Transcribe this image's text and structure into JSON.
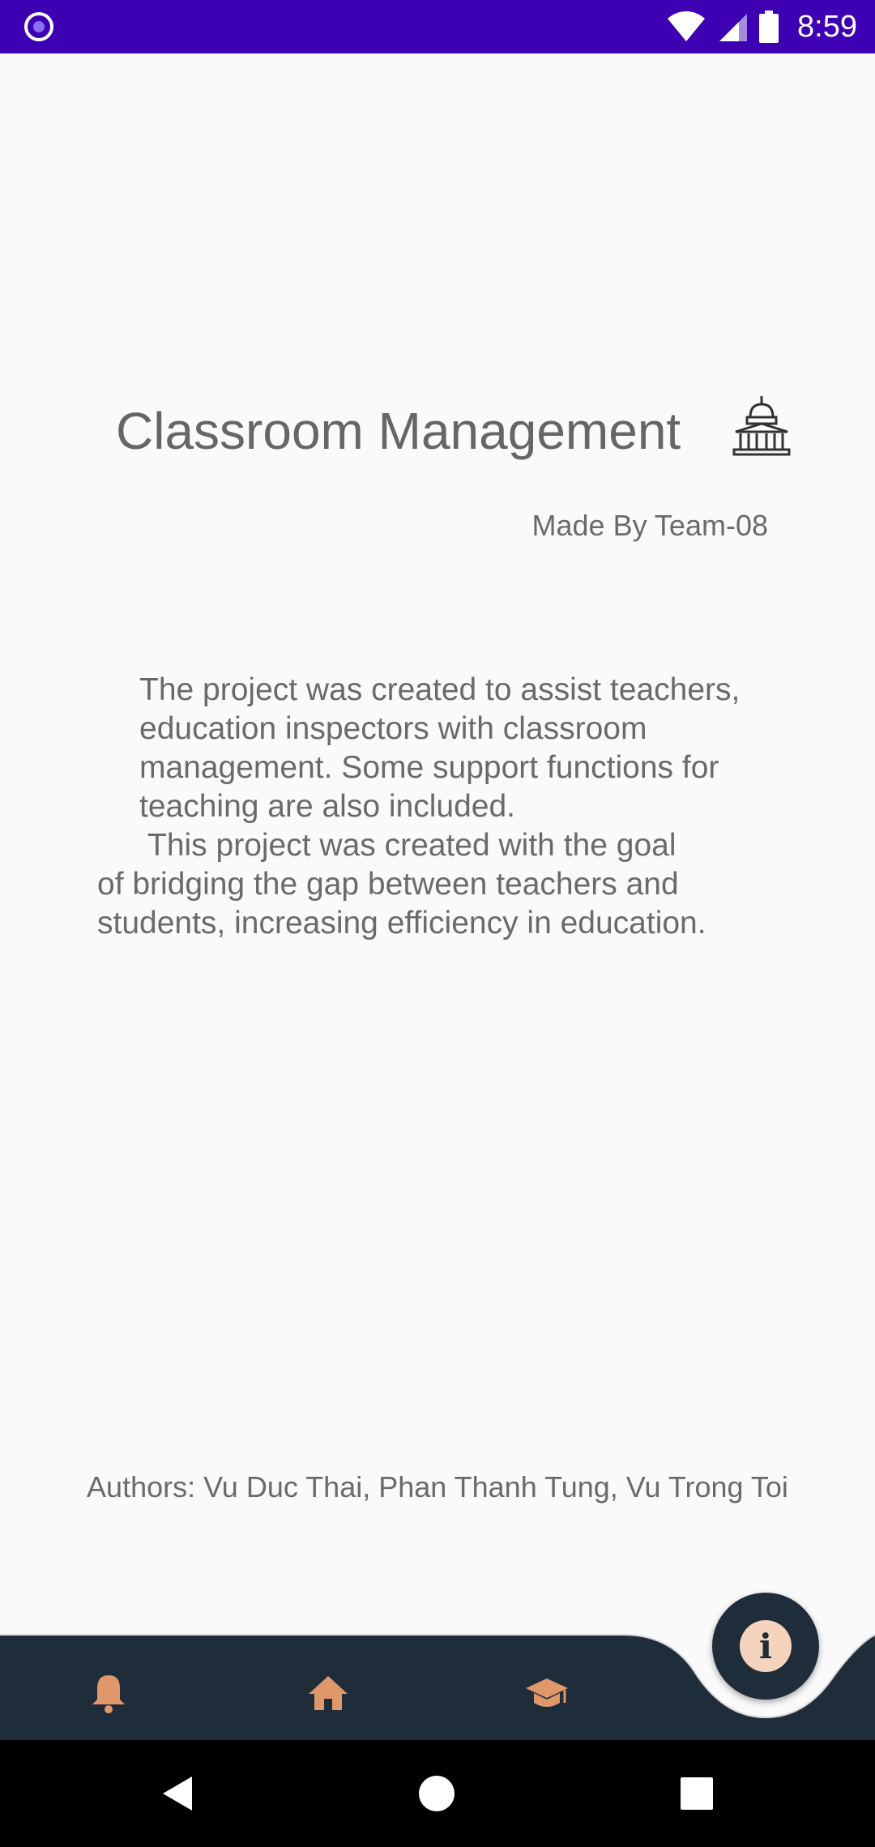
{
  "status_bar": {
    "time": "8:59",
    "icons": [
      "app-notification-icon",
      "wifi-icon",
      "signal-icon",
      "battery-icon"
    ]
  },
  "main": {
    "title": "Classroom Management",
    "title_icon": "building-icon",
    "subtitle": "Made By Team-08",
    "description": {
      "paragraph1": "The project was created to assist teachers, education inspectors with classroom management. Some support functions for teaching are also included.",
      "paragraph2_line1": "This project was created with the goal",
      "paragraph2_rest": "of bridging the gap between teachers and students, increasing efficiency in education."
    },
    "authors": "Authors: Vu Duc Thai, Phan Thanh Tung, Vu Trong Toi"
  },
  "bottom_nav": {
    "items": [
      {
        "icon": "bell-icon"
      },
      {
        "icon": "home-icon"
      },
      {
        "icon": "graduation-cap-icon"
      }
    ],
    "fab": {
      "icon": "info-icon",
      "glyph": "i"
    }
  },
  "colors": {
    "status_bar": "#3d00b3",
    "nav_background": "#1f2d3a",
    "nav_icon": "#e0976a",
    "fab_inner": "#f6d3bd",
    "text": "#6a6a6a"
  }
}
